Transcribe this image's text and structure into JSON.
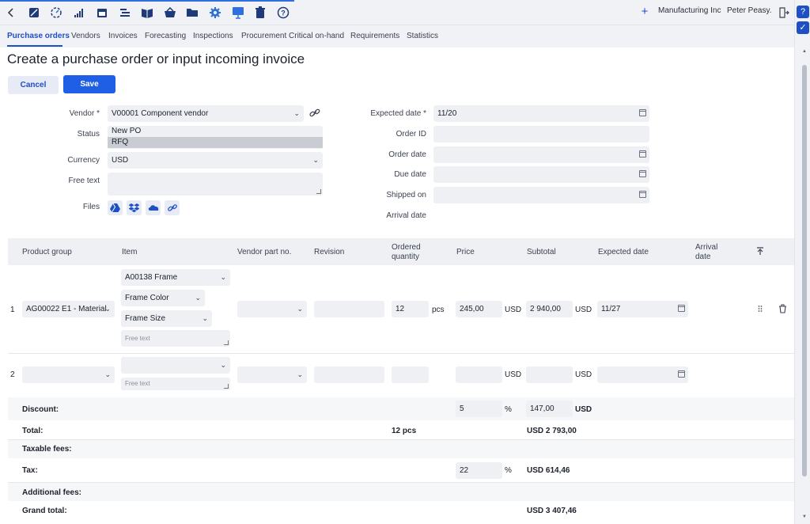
{
  "toolbar": {
    "icons": [
      "back-icon",
      "dashboard-icon",
      "gauge-icon",
      "chart-bars-icon",
      "calendar-icon",
      "list-icon",
      "book-icon",
      "basket-icon",
      "folder-icon",
      "gear-icon",
      "presentation-icon",
      "trash-icon",
      "help-icon"
    ],
    "company": "Manufacturing Inc",
    "user": "Peter Peasy."
  },
  "nav": {
    "tabs": [
      "Purchase orders",
      "Vendors",
      "Invoices",
      "Forecasting",
      "Inspections",
      "Procurement Critical on-hand",
      "Requirements",
      "Statistics"
    ],
    "active": "Purchase orders"
  },
  "page": {
    "title": "Create a purchase order or input incoming invoice",
    "cancel_label": "Cancel",
    "save_label": "Save"
  },
  "form": {
    "vendor_label": "Vendor *",
    "vendor_value": "V00001 Component vendor",
    "status_label": "Status",
    "status_options": [
      "New PO",
      "RFQ"
    ],
    "status_selected": "RFQ",
    "currency_label": "Currency",
    "currency_value": "USD",
    "free_text_label": "Free text",
    "files_label": "Files",
    "file_icons": [
      "google-drive-icon",
      "dropbox-icon",
      "onedrive-icon",
      "link-icon"
    ],
    "expected_date_label": "Expected date *",
    "expected_date_value": "11/20",
    "order_id_label": "Order ID",
    "order_date_label": "Order date",
    "due_date_label": "Due date",
    "shipped_on_label": "Shipped on",
    "arrival_date_label": "Arrival date"
  },
  "table": {
    "headers": {
      "product_group": "Product group",
      "item": "Item",
      "vendor_part": "Vendor part no.",
      "revision": "Revision",
      "ordered_qty_1": "Ordered",
      "ordered_qty_2": "quantity",
      "price": "Price",
      "subtotal": "Subtotal",
      "expected_date": "Expected date",
      "arrival_1": "Arrival",
      "arrival_2": "date"
    },
    "rows": [
      {
        "num": "1",
        "product_group": "AG00022 E1 - Material",
        "item": "A00138 Frame",
        "attr1": "Frame Color",
        "attr2": "Frame Size",
        "free_text_placeholder": "Free text",
        "quantity": "12",
        "unit": "pcs",
        "price": "245,00",
        "price_currency": "USD",
        "subtotal": "2 940,00",
        "subtotal_currency": "USD",
        "expected_date": "11/27"
      },
      {
        "num": "2",
        "free_text_placeholder": "Free text",
        "price_currency": "USD",
        "subtotal_currency": "USD"
      }
    ]
  },
  "summary": {
    "discount_label": "Discount:",
    "discount_pct": "5",
    "discount_unit": "%",
    "discount_amount": "147,00",
    "discount_currency": "USD",
    "total_label": "Total:",
    "total_qty": "12 pcs",
    "total_amount": "USD 2 793,00",
    "taxable_fees_label": "Taxable fees:",
    "tax_label": "Tax:",
    "tax_pct": "22",
    "tax_unit": "%",
    "tax_amount": "USD 614,46",
    "additional_fees_label": "Additional fees:",
    "grand_total_label": "Grand total:",
    "grand_total_amount": "USD 3 407,46"
  },
  "colors": {
    "accent": "#1f4fc4",
    "save_button": "#1e5fe6",
    "field_bg": "#eef0f4"
  }
}
